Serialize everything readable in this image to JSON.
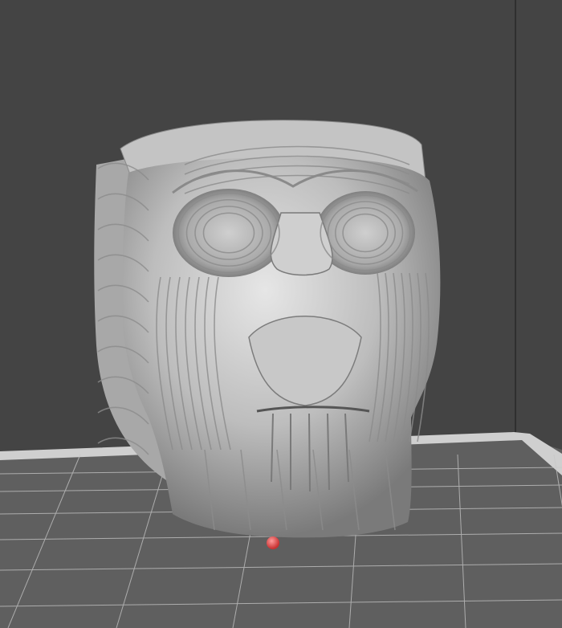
{
  "viewport": {
    "background": "#454545",
    "wall_background": "#444444",
    "wall_edge_line": "#2c2c2c"
  },
  "build_plate": {
    "surface_color": "#5f5f5f",
    "grid_line_color": "#c7c7c7",
    "border_color": "#cfcfcf"
  },
  "model": {
    "name": "skull-planter",
    "surface_color": "#bcbcbc",
    "highlight_color": "#e4e4e4",
    "shadow_color": "#6a6a6a"
  },
  "origin_marker": {
    "icon": "red-sphere-icon",
    "color": "#e24a4a"
  }
}
